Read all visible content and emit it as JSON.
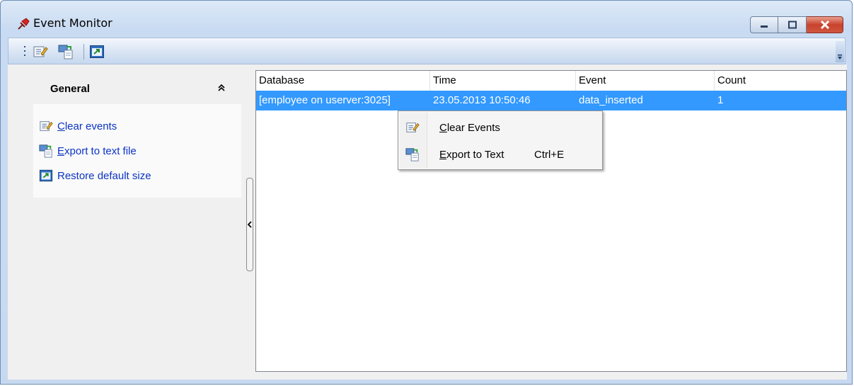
{
  "window": {
    "title": "Event Monitor",
    "accent": "#3399ff",
    "link_color": "#0b34c5"
  },
  "caption_buttons": {
    "minimize_icon": "minimize-icon",
    "maximize_icon": "maximize-icon",
    "close_icon": "close-icon"
  },
  "toolbar": {
    "buttons": [
      {
        "icon": "clear-events-icon"
      },
      {
        "icon": "export-to-text-icon"
      },
      {
        "icon": "restore-default-size-icon"
      }
    ]
  },
  "sidebar": {
    "group_title": "General",
    "items": [
      {
        "label": "Clear events",
        "icon": "clear-events-icon"
      },
      {
        "label": "Export to text file",
        "icon": "export-to-text-icon"
      },
      {
        "label": "Restore default size",
        "icon": "restore-default-size-icon"
      }
    ]
  },
  "grid": {
    "columns": [
      "Database",
      "Time",
      "Event",
      "Count"
    ],
    "rows": [
      [
        "[employee on userver:3025]",
        "23.05.2013 10:50:46",
        "data_inserted",
        "1"
      ]
    ]
  },
  "context_menu": {
    "items": [
      {
        "label": "Clear Events",
        "shortcut": "",
        "icon": "clear-events-icon"
      },
      {
        "label": "Export to Text",
        "shortcut": "Ctrl+E",
        "icon": "export-to-text-icon"
      }
    ]
  }
}
